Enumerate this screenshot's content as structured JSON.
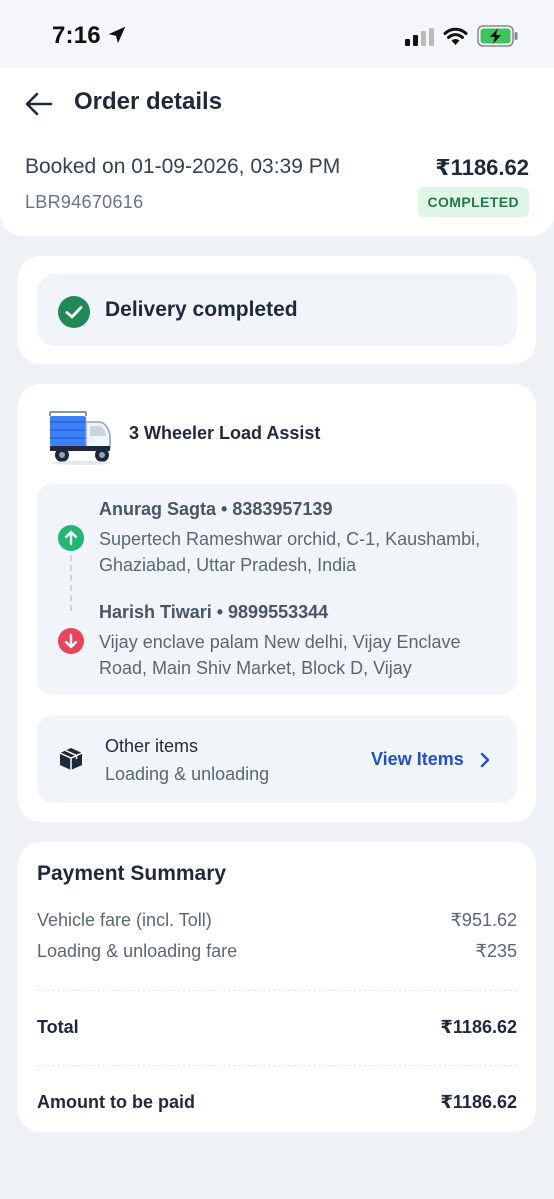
{
  "status_bar": {
    "time": "7:16"
  },
  "header": {
    "title": "Order details",
    "booked_on": "Booked on 01-09-2026, 03:39 PM",
    "order_id": "LBR94670616",
    "amount": "₹1186.62",
    "status": "COMPLETED"
  },
  "delivery": {
    "status_text": "Delivery completed"
  },
  "trip": {
    "vehicle": "3 Wheeler Load Assist",
    "pickup": {
      "name": "Anurag Sagta",
      "phone": "• 8383957139",
      "address": "Supertech Rameshwar orchid, C-1, Kaushambi, Ghaziabad, Uttar Pradesh, India"
    },
    "drop": {
      "name": "Harish Tiwari",
      "phone": "• 9899553344",
      "address": "Vijay enclave palam New delhi, Vijay Enclave Road, Main Shiv Market, Block D, Vijay"
    },
    "items": {
      "title": "Other items",
      "subtitle": "Loading & unloading",
      "action": "View Items"
    }
  },
  "payment": {
    "title": "Payment Summary",
    "rows": [
      {
        "label": "Vehicle fare (incl. Toll)",
        "value": "₹951.62"
      },
      {
        "label": "Loading & unloading fare",
        "value": "₹235"
      }
    ],
    "total_label": "Total",
    "total_value": "₹1186.62",
    "to_pay_label": "Amount to be paid",
    "to_pay_value": "₹1186.62"
  },
  "colors": {
    "accent_blue": "#1d4fd8",
    "success_green": "#1f8a57",
    "drop_red": "#e8455a",
    "badge_bg": "#dff5e6"
  }
}
